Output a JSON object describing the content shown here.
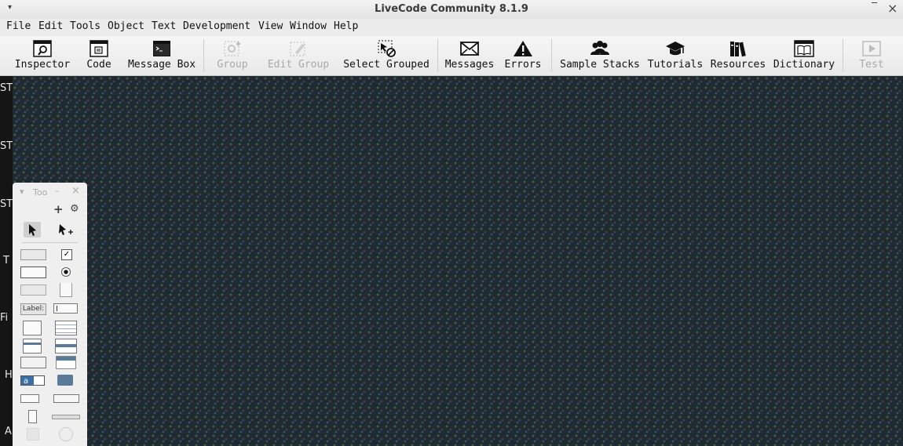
{
  "window": {
    "title": "LiveCode Community 8.1.9",
    "menu_glyph": "▾",
    "minimize_glyph": "‾",
    "close_glyph": "×"
  },
  "menubar": {
    "items": [
      "File",
      "Edit",
      "Tools",
      "Object",
      "Text",
      "Development",
      "View",
      "Window",
      "Help"
    ]
  },
  "toolbar": {
    "items": [
      {
        "label": "Inspector",
        "icon": "inspector-icon",
        "enabled": true
      },
      {
        "label": "Code",
        "icon": "code-icon",
        "enabled": true
      },
      {
        "label": "Message Box",
        "icon": "message-box-icon",
        "enabled": true
      },
      {
        "label": "Group",
        "icon": "group-icon",
        "enabled": false
      },
      {
        "label": "Edit Group",
        "icon": "edit-group-icon",
        "enabled": false
      },
      {
        "label": "Select Grouped",
        "icon": "select-grouped-icon",
        "enabled": true
      },
      {
        "label": "Messages",
        "icon": "envelope-icon",
        "enabled": true
      },
      {
        "label": "Errors",
        "icon": "warning-icon",
        "enabled": true
      },
      {
        "label": "Sample Stacks",
        "icon": "people-icon",
        "enabled": true
      },
      {
        "label": "Tutorials",
        "icon": "graduation-cap-icon",
        "enabled": true
      },
      {
        "label": "Resources",
        "icon": "books-icon",
        "enabled": true
      },
      {
        "label": "Dictionary",
        "icon": "book-icon",
        "enabled": true
      },
      {
        "label": "Test",
        "icon": "play-icon",
        "enabled": false
      }
    ]
  },
  "left_strip": {
    "labels": [
      "STO",
      "STO",
      "STO",
      "T",
      "Fi",
      "H",
      "A"
    ]
  },
  "tools_palette": {
    "title": "Too",
    "collapse_glyph": "▾",
    "minimize_glyph": "–",
    "close_glyph": "×",
    "add_glyph": "+",
    "gear_glyph": "⚙",
    "label_widget_text": "Label:",
    "checkbox_glyph": "✓",
    "combo_text": "a",
    "field_cursor": "I"
  },
  "colors": {
    "desktop": "#1f2b33",
    "chrome": "#ececec",
    "disabled_text": "#a9a9a9"
  }
}
